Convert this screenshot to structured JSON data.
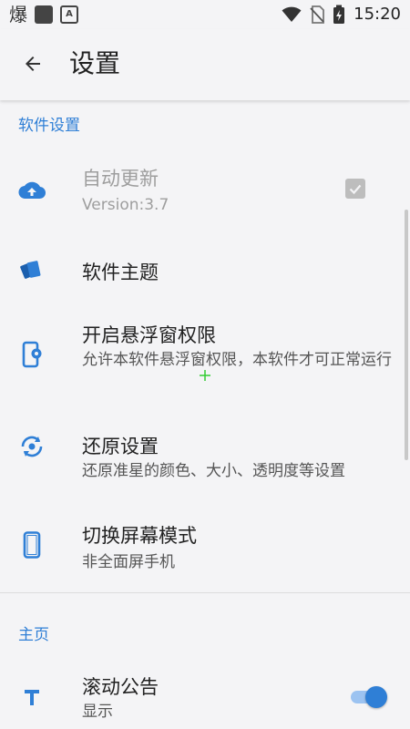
{
  "status_bar": {
    "notification_glyph": "爆",
    "time": "15:20",
    "icons": [
      "app-notification-icon",
      "square-icon",
      "a-app-icon",
      "wifi-icon",
      "no-sim-icon",
      "battery-icon"
    ]
  },
  "app_bar": {
    "title": "设置",
    "back_icon": "arrow-back-icon"
  },
  "sections": [
    {
      "header": "软件设置",
      "items": [
        {
          "title": "自动更新",
          "summary": "Version:3.7",
          "icon": "cloud-upload-icon",
          "enabled": false,
          "checked": true
        },
        {
          "title": "软件主题",
          "icon": "color-cards-icon"
        },
        {
          "title": "开启悬浮窗权限",
          "summary": "允许本软件悬浮窗权限，本软件才可正常运行",
          "icon": "phone-settings-icon"
        },
        {
          "title": "还原设置",
          "summary": "还原准星的颜色、大小、透明度等设置",
          "icon": "restore-eye-icon"
        },
        {
          "title": "切换屏幕模式",
          "summary": "非全面屏手机",
          "icon": "phone-icon"
        }
      ]
    },
    {
      "header": "主页",
      "items": [
        {
          "title": "滚动公告",
          "summary": "显示",
          "icon": "text-t-icon",
          "toggle_on": true
        }
      ]
    }
  ],
  "colors": {
    "accent": "#2f7fd6",
    "background": "#f4f4f6",
    "disabled_text": "#9e9e9e",
    "crosshair": "#33cc33"
  }
}
